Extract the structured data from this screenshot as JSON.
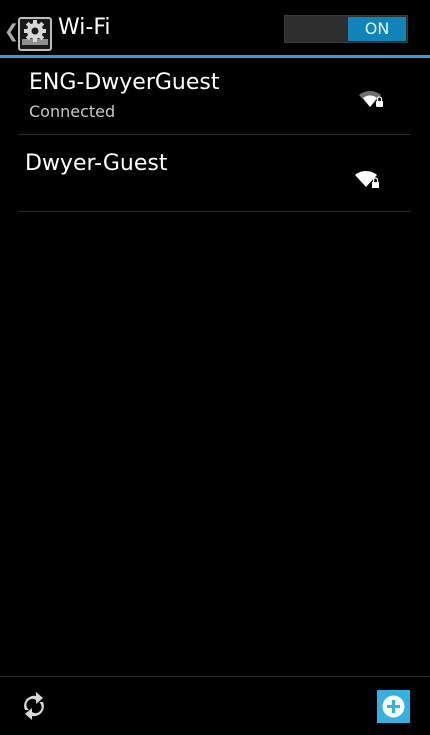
{
  "action_bar": {
    "title": "Wi-Fi",
    "back_icon": "chevron-left-icon",
    "app_icon": "settings-gear-icon"
  },
  "wifi_toggle": {
    "state_label": "ON",
    "enabled": true,
    "accent_color": "#0e84b8"
  },
  "networks": [
    {
      "ssid": "ENG-DwyerGuest",
      "status": "Connected",
      "signal_icon": "wifi-signal-locked-icon"
    },
    {
      "ssid": "Dwyer-Guest",
      "status": "",
      "signal_icon": "wifi-signal-locked-icon"
    }
  ],
  "bottom_bar": {
    "scan_icon": "refresh-scan-icon",
    "add_icon": "add-network-icon"
  },
  "colors": {
    "background": "#000000",
    "accent": "#2aa2d6",
    "toggle_on": "#0e84b8"
  }
}
